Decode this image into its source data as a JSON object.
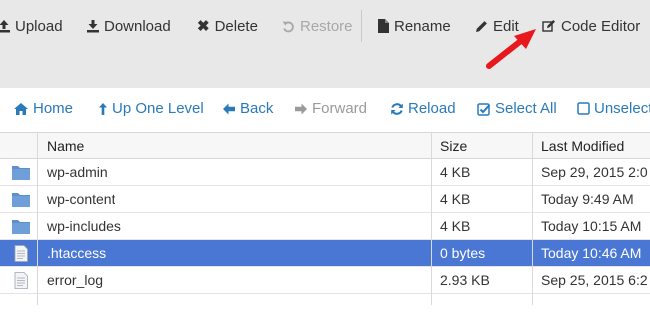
{
  "toolbar": {
    "upload": "Upload",
    "download": "Download",
    "delete": "Delete",
    "restore": "Restore",
    "rename": "Rename",
    "edit": "Edit",
    "code_editor": "Code Editor"
  },
  "navbar": {
    "home": "Home",
    "up_one_level": "Up One Level",
    "back": "Back",
    "forward": "Forward",
    "reload": "Reload",
    "select_all": "Select All",
    "unselect": "Unselect"
  },
  "table": {
    "headers": {
      "name": "Name",
      "size": "Size",
      "modified": "Last Modified"
    },
    "rows": [
      {
        "name": "wp-admin",
        "size": "4 KB",
        "modified": "Sep 29, 2015 2:0",
        "type": "folder-icon"
      },
      {
        "name": "wp-content",
        "size": "4 KB",
        "modified": "Today 9:49 AM",
        "type": "folder-icon"
      },
      {
        "name": "wp-includes",
        "size": "4 KB",
        "modified": "Today 10:15 AM",
        "type": "folder-icon"
      },
      {
        "name": ".htaccess",
        "size": "0 bytes",
        "modified": "Today 10:46 AM",
        "type": "file-icon",
        "selected": true
      },
      {
        "name": "error_log",
        "size": "2.93 KB",
        "modified": "Sep 25, 2015 6:2",
        "type": "file-icon"
      }
    ]
  },
  "colors": {
    "toolbar_bg": "#e8e8e8",
    "link": "#2a7ab9",
    "selected_row": "#4a77d4",
    "arrow": "#e8191e"
  }
}
